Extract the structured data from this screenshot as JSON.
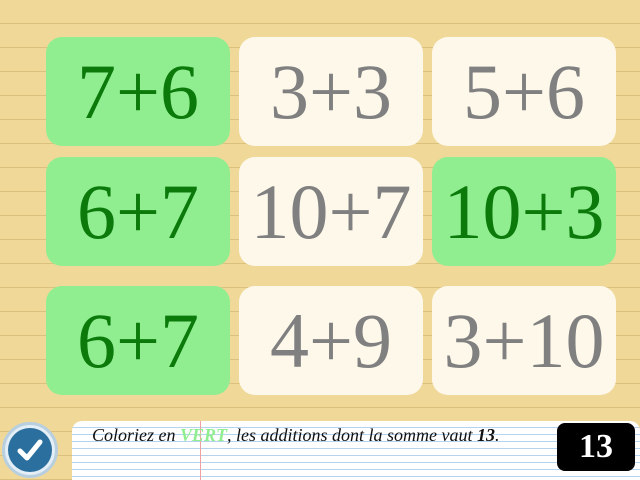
{
  "tiles": [
    {
      "label": "7+6",
      "state": "green"
    },
    {
      "label": "3+3",
      "state": "plain"
    },
    {
      "label": "5+6",
      "state": "plain"
    },
    {
      "label": "6+7",
      "state": "green"
    },
    {
      "label": "10+7",
      "state": "plain"
    },
    {
      "label": "10+3",
      "state": "green"
    },
    {
      "label": "6+7",
      "state": "green"
    },
    {
      "label": "4+9",
      "state": "plain"
    },
    {
      "label": "3+10",
      "state": "plain"
    }
  ],
  "instruction": {
    "prefix": "Coloriez en ",
    "color_word": "VERT",
    "middle": ", les additions dont la somme vaut ",
    "target": "13",
    "suffix": "."
  },
  "target_display": "13",
  "check_icon": "checkmark-icon",
  "colors": {
    "green_tile_bg": "#90ee90",
    "green_tile_text": "#0b7a0b",
    "plain_tile_bg": "#fdf8ea",
    "plain_tile_text": "#808080",
    "background": "#efd898"
  }
}
